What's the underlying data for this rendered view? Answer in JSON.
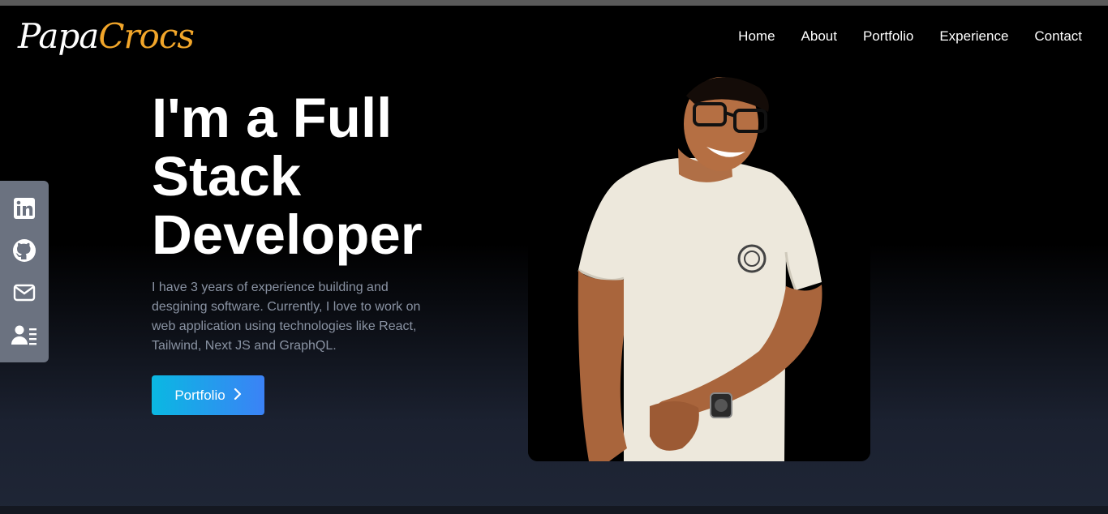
{
  "brand": {
    "logo_part1": "Papa",
    "logo_part2": "Crocs",
    "accent_color": "#f2a62a"
  },
  "nav": {
    "items": [
      "Home",
      "About",
      "Portfolio",
      "Experience",
      "Contact"
    ]
  },
  "social": {
    "icons": [
      "linkedin-icon",
      "github-icon",
      "mail-icon",
      "resume-icon"
    ]
  },
  "hero": {
    "title_lines": [
      "I'm a Full",
      "Stack",
      "Developer"
    ],
    "description": "I have 3 years of experience building and desgining software. Currently, I love to work on web application using technologies like React, Tailwind, Next JS and GraphQL.",
    "button_label": "Portfolio",
    "button_colors": [
      "#0ab8e2",
      "#3b82f6"
    ]
  }
}
